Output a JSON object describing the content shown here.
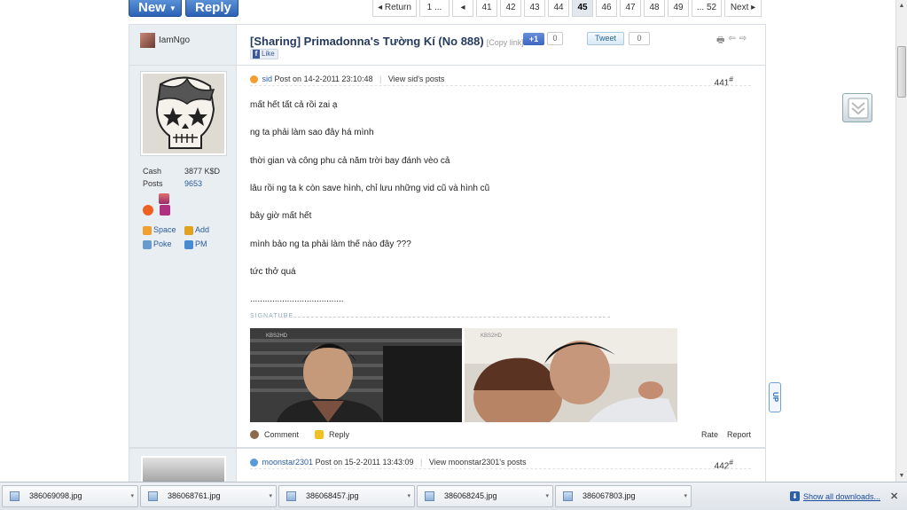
{
  "toolbar": {
    "new_label": "New",
    "reply_label": "Reply",
    "caret": "▼"
  },
  "pager": {
    "items": [
      "◂ Return",
      "1 ...",
      "◂",
      "41",
      "42",
      "43",
      "44",
      "45",
      "46",
      "47",
      "48",
      "49",
      "... 52",
      "Next ▸"
    ],
    "current": "45"
  },
  "thread": {
    "starter": "IamNgo",
    "title": "[Sharing] Primadonna's Tường Kí (No 888)",
    "copy_link": "[Copy link]",
    "plus1": "+1",
    "plus1_count": "0",
    "tweet": "Tweet",
    "tweet_count": "0",
    "fb_like": "Like",
    "fb_mark": "f",
    "tool_icons": [
      "🖶",
      "⇦",
      "⇨"
    ]
  },
  "post1": {
    "stats": [
      {
        "label": "Cash",
        "value": "3877 K$D"
      },
      {
        "label": "Posts",
        "value": "9653"
      }
    ],
    "links": [
      "Space",
      "Add",
      "Poke",
      "PM"
    ],
    "user": "sid",
    "posted": "Post on 14-2-2011 23:10:48",
    "view_posts": "View sid's posts",
    "number": "441",
    "number_sup": "#",
    "lines": [
      "mất hết tất cả rồi zai ạ",
      "ng ta phải làm sao đây há mình",
      "thời gian và công phu cả năm trời bay đánh vèo cả",
      "lâu rồi ng ta k còn save hình, chỉ lưu những vid cũ và hình cũ",
      "bây giờ mất hết",
      "mình bảo ng ta phải làm thế nào đây ???",
      "tức thở quá"
    ],
    "dots": "......................................",
    "signature_label": "SIGNATURE",
    "sig_captions": [
      "KBS2HD",
      "KBS2HD"
    ],
    "comment": "Comment",
    "reply": "Reply",
    "rate": "Rate",
    "report": "Report"
  },
  "post2": {
    "user": "moonstar2301",
    "posted": "Post on 15-2-2011 13:43:09",
    "view_posts": "View moonstar2301's posts",
    "number": "442",
    "number_sup": "#"
  },
  "widgets": {
    "up": "UP"
  },
  "scrollbar": {
    "up": "▲",
    "down": "▼"
  },
  "downloads": {
    "files": [
      "386069098.jpg",
      "386068761.jpg",
      "386068457.jpg",
      "386068245.jpg",
      "386067803.jpg"
    ],
    "caret": "▾",
    "arrow": "⬇",
    "show_all": "Show all downloads...",
    "close": "✕"
  }
}
